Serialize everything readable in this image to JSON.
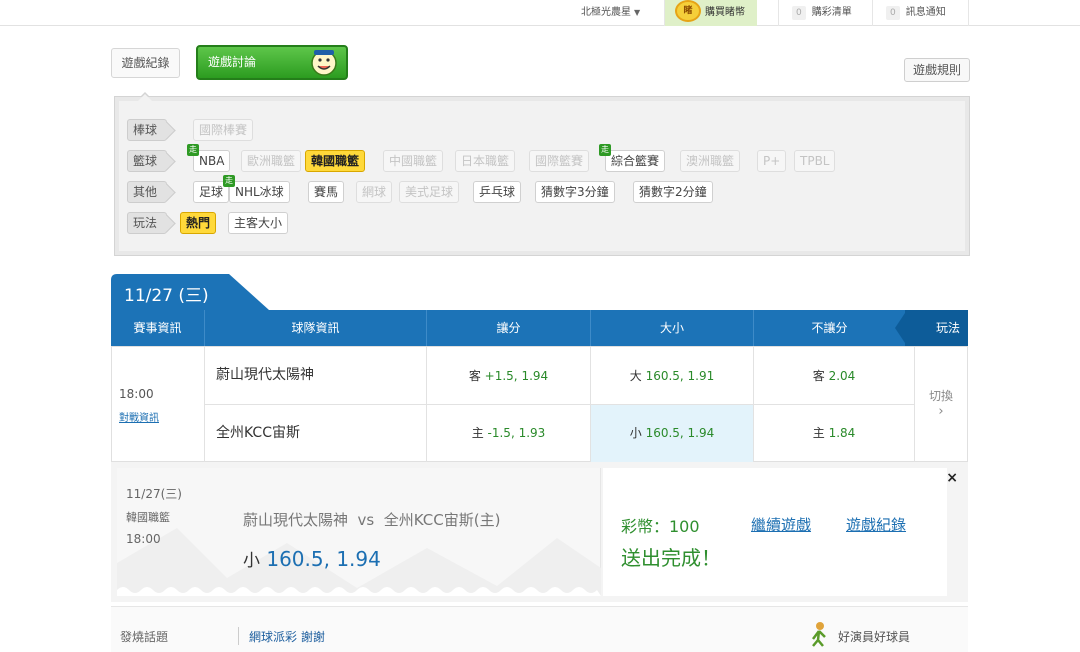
{
  "topbar": {
    "location": "北極光農星",
    "coin_label": "購買睹幣",
    "coin_icon_text": "睹",
    "cart_count": "0",
    "cart_label": "購彩清單",
    "msg_count": "0",
    "msg_label": "訊息通知"
  },
  "nav": {
    "record": "遊戲紀錄",
    "discuss": "遊戲討論",
    "rules": "遊戲規則"
  },
  "filters": {
    "baseball": {
      "label": "棒球",
      "tags": [
        "國際棒賽"
      ]
    },
    "basketball": {
      "label": "籃球",
      "tags": [
        "NBA",
        "歐洲職籃",
        "韓國職籃",
        "中國職籃",
        "日本職籃",
        "國際籃賽",
        "綜合籃賽",
        "澳洲職籃",
        "P+",
        "TPBL"
      ]
    },
    "other": {
      "label": "其他",
      "tags": [
        "足球",
        "NHL冰球",
        "賽馬",
        "網球",
        "美式足球",
        "乒乓球",
        "猜數字3分鐘",
        "猜數字2分鐘"
      ]
    },
    "play": {
      "label": "玩法",
      "tags": [
        "熱門",
        "主客大小"
      ]
    },
    "live_badge": "走"
  },
  "table": {
    "date": "11/27 (三)",
    "headers": [
      "賽事資訊",
      "球隊資訊",
      "讓分",
      "大小",
      "不讓分",
      "玩法"
    ],
    "time": "18:00",
    "detail_link": "對戰資訊",
    "switch": "切換",
    "rows": [
      {
        "team": "蔚山現代太陽神",
        "spread_side": "客",
        "spread": "+1.5, 1.94",
        "total_side": "大",
        "total": "160.5, 1.91",
        "ml_side": "客",
        "ml": "2.04"
      },
      {
        "team": "全州KCC宙斯",
        "spread_side": "主",
        "spread": "-1.5, 1.93",
        "total_side": "小",
        "total": "160.5, 1.94",
        "ml_side": "主",
        "ml": "1.84"
      }
    ]
  },
  "bet": {
    "date": "11/27(三)",
    "league": "韓國職籃",
    "time": "18:00",
    "matchup": "蔚山現代太陽神  vs  全州KCC宙斯(主)",
    "pick_side": "小",
    "pick_value": "160.5, 1.94",
    "stake": "彩幣：100",
    "status": "送出完成！",
    "continue": "繼續遊戲",
    "records": "遊戲紀錄",
    "close": "×"
  },
  "footer": {
    "topic_label": "發燒話題",
    "topic_text": "網球派彩 謝謝",
    "right_text": "好演員好球員"
  }
}
